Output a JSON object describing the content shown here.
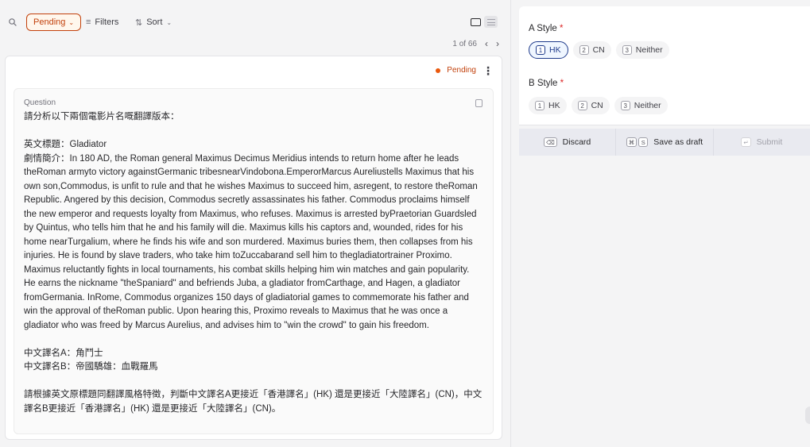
{
  "toolbar": {
    "pending_label": "Pending",
    "filters_label": "Filters",
    "sort_label": "Sort"
  },
  "pager": {
    "text": "1 of 66",
    "prev": "‹",
    "next": "›"
  },
  "card": {
    "status": "Pending",
    "question_label": "Question",
    "question_text": "請分析以下兩個電影片名嘅翻譯版本：\n\n英文標題：Gladiator\n劇情簡介：In 180 AD, the Roman general Maximus Decimus Meridius intends to return home after he leads theRoman armyto victory againstGermanic tribesnearVindobona.EmperorMarcus Aureliustells Maximus that his own son,Commodus, is unfit to rule and that he wishes Maximus to succeed him, asregent, to restore theRoman Republic. Angered by this decision, Commodus secretly assassinates his father. Commodus proclaims himself the new emperor and requests loyalty from Maximus, who refuses. Maximus is arrested byPraetorian Guardsled by Quintus, who tells him that he and his family will die. Maximus kills his captors and, wounded, rides for his home nearTurgalium, where he finds his wife and son murdered. Maximus buries them, then collapses from his injuries. He is found by slave traders, who take him toZuccabarand sell him to thegladiatortrainer Proximo. Maximus reluctantly fights in local tournaments, his combat skills helping him win matches and gain popularity. He earns the nickname \"theSpaniard\" and befriends Juba, a gladiator fromCarthage, and Hagen, a gladiator fromGermania. InRome, Commodus organizes 150 days of gladiatorial games to commemorate his father and win the approval of theRoman public. Upon hearing this, Proximo reveals to Maximus that he was once a gladiator who was freed by Marcus Aurelius, and advises him to \"win the crowd\" to gain his freedom.\n\n中文譯名A：角鬥士\n中文譯名B：帝國驕雄：血戰羅馬\n\n請根據英文原標題同翻譯風格特徵，判斷中文譯名A更接近「香港譯名」(HK) 還是更接近「大陸譯名」(CN)，中文譯名B更接近「香港譯名」(HK) 還是更接近「大陸譯名」(CN)。"
  },
  "form": {
    "a_style": {
      "label": "A Style",
      "required_mark": "*",
      "options": [
        {
          "key": "1",
          "label": "HK",
          "selected": true
        },
        {
          "key": "2",
          "label": "CN",
          "selected": false
        },
        {
          "key": "3",
          "label": "Neither",
          "selected": false
        }
      ]
    },
    "b_style": {
      "label": "B Style",
      "required_mark": "*",
      "options": [
        {
          "key": "1",
          "label": "HK",
          "selected": false
        },
        {
          "key": "2",
          "label": "CN",
          "selected": false
        },
        {
          "key": "3",
          "label": "Neither",
          "selected": false
        }
      ]
    }
  },
  "actions": {
    "discard": {
      "key": "⌫",
      "label": "Discard"
    },
    "save_draft": {
      "key1": "⌘",
      "key2": "S",
      "label": "Save as draft"
    },
    "submit": {
      "key": "↵",
      "label": "Submit"
    }
  },
  "colors": {
    "accent_pending": "#c2410c",
    "selected_option": "#1e3a8a",
    "required": "#dc2626"
  }
}
